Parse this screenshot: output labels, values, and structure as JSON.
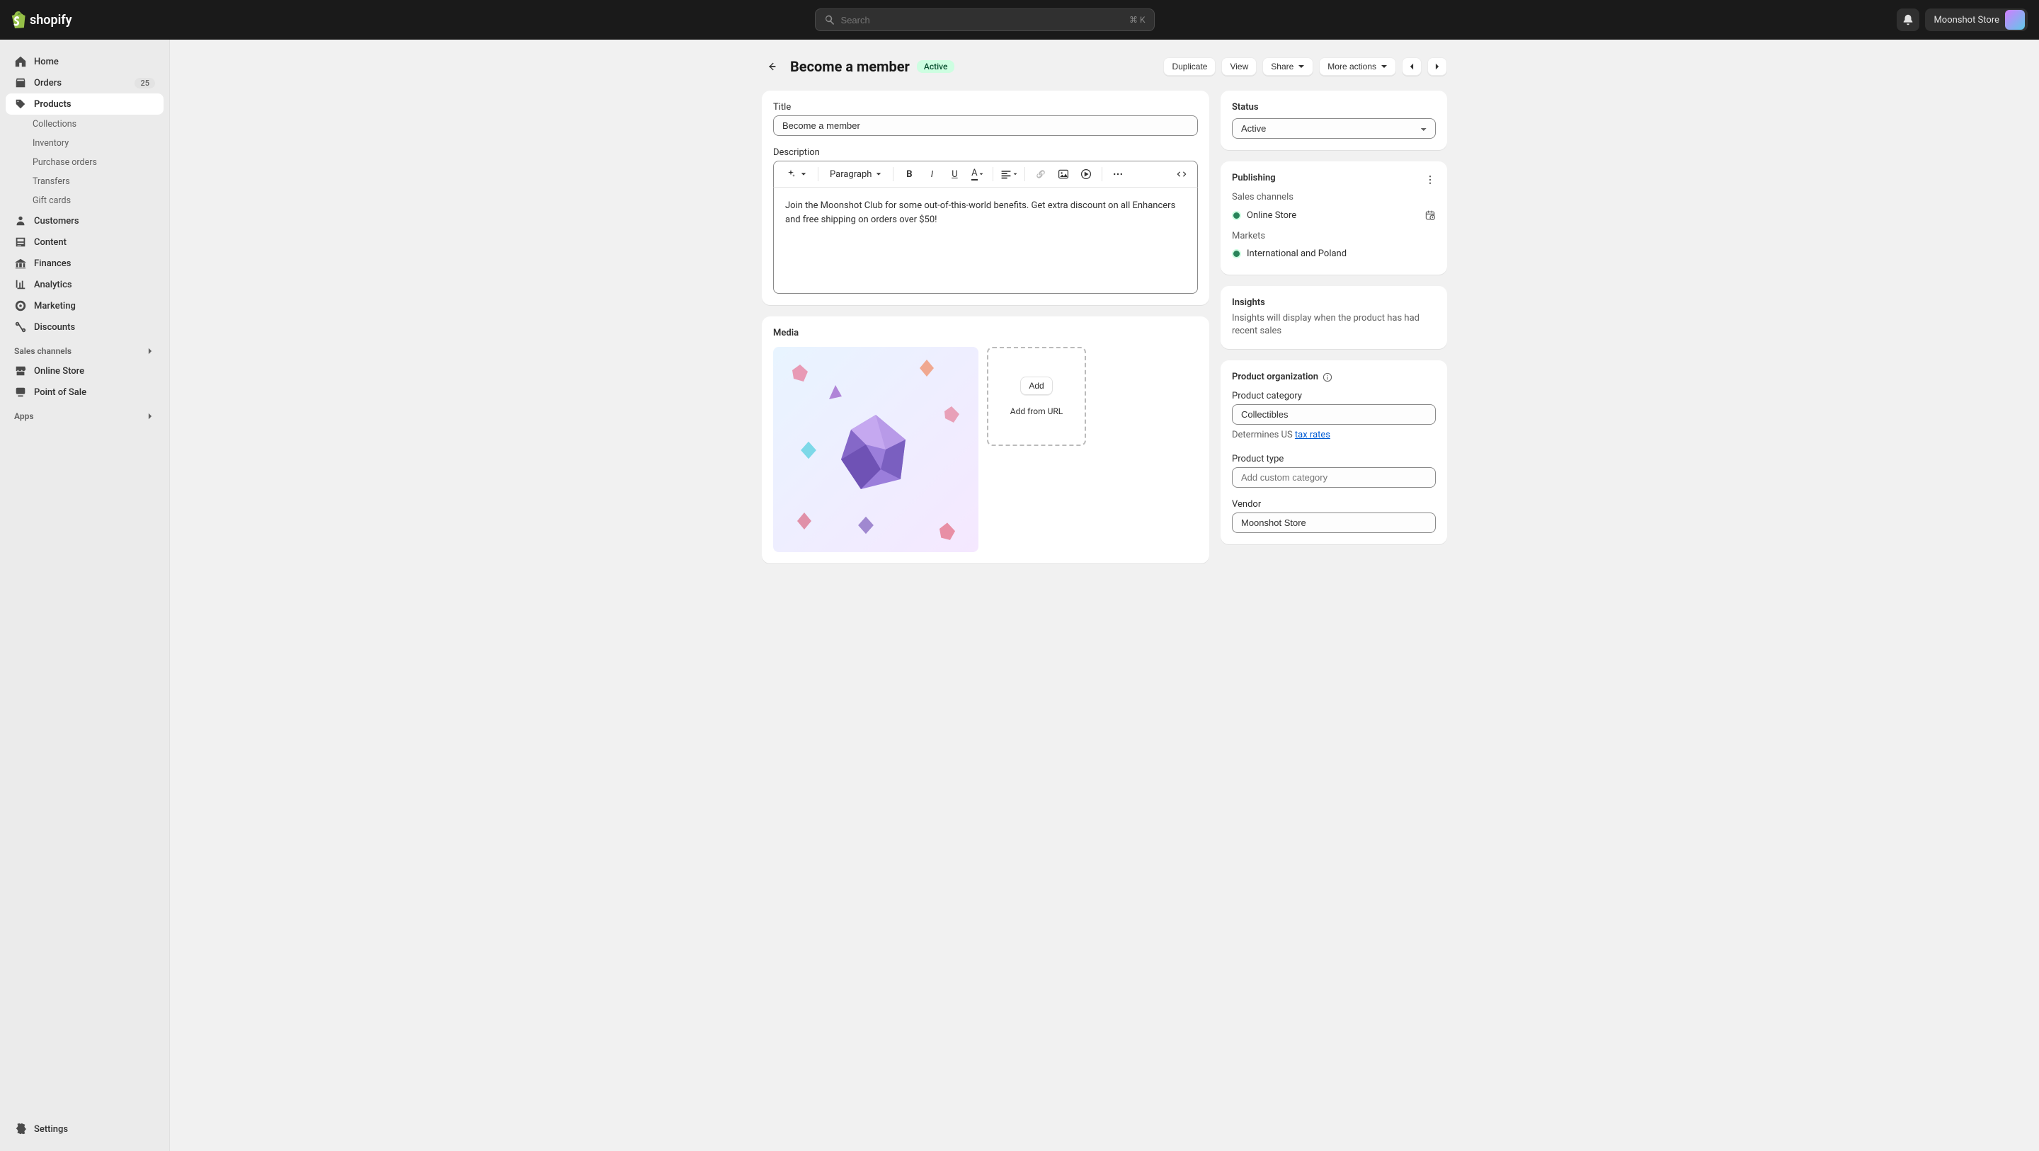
{
  "topbar": {
    "logo_text": "shopify",
    "search_placeholder": "Search",
    "search_shortcut": "⌘ K",
    "store_name": "Moonshot Store"
  },
  "sidebar": {
    "items": [
      {
        "label": "Home"
      },
      {
        "label": "Orders",
        "badge": "25"
      },
      {
        "label": "Products"
      },
      {
        "label": "Collections",
        "sub": true
      },
      {
        "label": "Inventory",
        "sub": true
      },
      {
        "label": "Purchase orders",
        "sub": true
      },
      {
        "label": "Transfers",
        "sub": true
      },
      {
        "label": "Gift cards",
        "sub": true
      },
      {
        "label": "Customers"
      },
      {
        "label": "Content"
      },
      {
        "label": "Finances"
      },
      {
        "label": "Analytics"
      },
      {
        "label": "Marketing"
      },
      {
        "label": "Discounts"
      }
    ],
    "sales_channels_label": "Sales channels",
    "channels": [
      {
        "label": "Online Store"
      },
      {
        "label": "Point of Sale"
      }
    ],
    "apps_label": "Apps",
    "settings_label": "Settings"
  },
  "page": {
    "title": "Become a member",
    "status": "Active",
    "actions": {
      "duplicate": "Duplicate",
      "view": "View",
      "share": "Share",
      "more": "More actions"
    }
  },
  "product": {
    "title_label": "Title",
    "title_value": "Become a member",
    "description_label": "Description",
    "paragraph_label": "Paragraph",
    "description_text": "Join the Moonshot Club for some out-of-this-world benefits. Get extra discount on all Enhancers and free shipping on orders over $50!",
    "media_label": "Media",
    "media_add_label": "Add",
    "media_url_label": "Add from URL"
  },
  "status_card": {
    "heading": "Status",
    "value": "Active"
  },
  "publishing": {
    "heading": "Publishing",
    "sales_channels_label": "Sales channels",
    "channels": [
      {
        "label": "Online Store"
      }
    ],
    "markets_label": "Markets",
    "markets": [
      {
        "label": "International and Poland"
      }
    ]
  },
  "insights": {
    "heading": "Insights",
    "text": "Insights will display when the product has had recent sales"
  },
  "organization": {
    "heading": "Product organization",
    "category_label": "Product category",
    "category_value": "Collectibles",
    "determines_text": "Determines US ",
    "tax_link": "tax rates",
    "type_label": "Product type",
    "type_placeholder": "Add custom category",
    "vendor_label": "Vendor",
    "vendor_value": "Moonshot Store"
  }
}
